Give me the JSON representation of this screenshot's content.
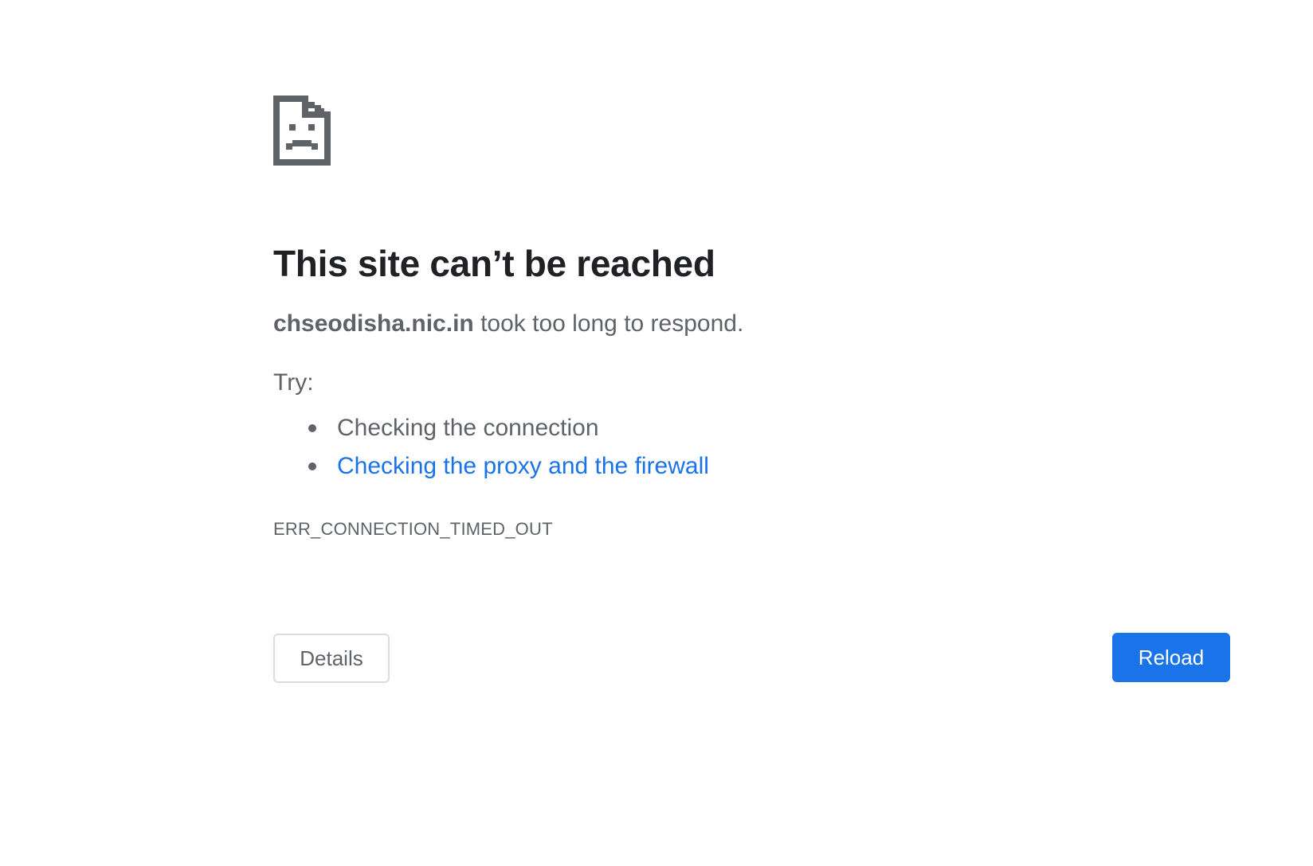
{
  "icon": {
    "name": "sad-document-icon",
    "color": "#5f6368"
  },
  "heading": "This site can’t be reached",
  "summary": {
    "host": "chseodisha.nic.in",
    "message": " took too long to respond."
  },
  "try_label": "Try:",
  "suggestions": [
    {
      "text": "Checking the connection",
      "is_link": false
    },
    {
      "text": "Checking the proxy and the firewall",
      "is_link": true
    }
  ],
  "error_code": "ERR_CONNECTION_TIMED_OUT",
  "buttons": {
    "details_label": "Details",
    "reload_label": "Reload"
  },
  "colors": {
    "text_primary": "#202124",
    "text_secondary": "#5f6368",
    "link": "#1a73e8",
    "primary_button": "#1a73e8"
  }
}
